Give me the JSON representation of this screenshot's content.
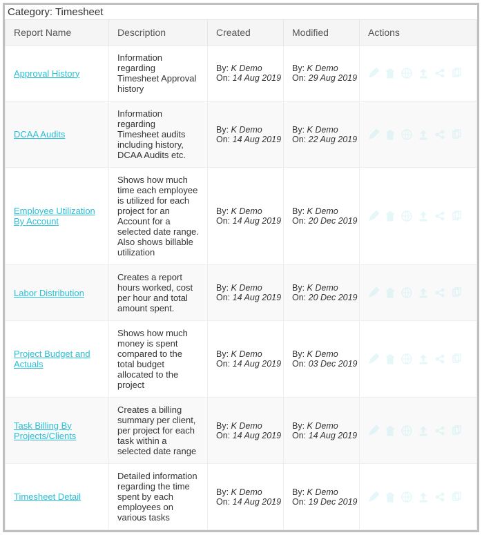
{
  "category_label_prefix": "Category: ",
  "category": "Timesheet",
  "headers": {
    "report_name": "Report Name",
    "description": "Description",
    "created": "Created",
    "modified": "Modified",
    "actions": "Actions"
  },
  "by_label": "By: ",
  "on_label": "On: ",
  "action_icons": [
    "edit-icon",
    "delete-icon",
    "globe-icon",
    "upload-icon",
    "share-icon",
    "copy-icon"
  ],
  "rows": [
    {
      "name": "Approval History",
      "description": "Information regarding Timesheet Approval history",
      "created_by": "K Demo",
      "created_on": "14 Aug 2019",
      "modified_by": "K Demo",
      "modified_on": "29 Aug 2019"
    },
    {
      "name": "DCAA Audits",
      "description": "Information regarding Timesheet audits including history, DCAA Audits etc.",
      "created_by": "K Demo",
      "created_on": "14 Aug 2019",
      "modified_by": "K Demo",
      "modified_on": "22 Aug 2019"
    },
    {
      "name": "Employee Utilization By Account",
      "description": "Shows how much time each employee is utilized for each project for an Account for a selected date range. Also shows billable utilization",
      "created_by": "K Demo",
      "created_on": "14 Aug 2019",
      "modified_by": "K Demo",
      "modified_on": "20 Dec 2019"
    },
    {
      "name": "Labor Distribution",
      "description": "Creates a report hours worked, cost per hour and total amount spent.",
      "created_by": "K Demo",
      "created_on": "14 Aug 2019",
      "modified_by": "K Demo",
      "modified_on": "20 Dec 2019"
    },
    {
      "name": "Project Budget and Actuals",
      "description": "Shows how much money is spent compared to the total budget allocated to the project",
      "created_by": "K Demo",
      "created_on": "14 Aug 2019",
      "modified_by": "K Demo",
      "modified_on": "03 Dec 2019"
    },
    {
      "name": "Task Billing By Projects/Clients",
      "description": "Creates a billing summary per client, per project for each task within a selected date range",
      "created_by": "K Demo",
      "created_on": "14 Aug 2019",
      "modified_by": "K Demo",
      "modified_on": "14 Aug 2019"
    },
    {
      "name": "Timesheet Detail",
      "description": "Detailed information regarding the time spent by each employees on various tasks",
      "created_by": "K Demo",
      "created_on": "14 Aug 2019",
      "modified_by": "K Demo",
      "modified_on": "19 Dec 2019"
    }
  ]
}
